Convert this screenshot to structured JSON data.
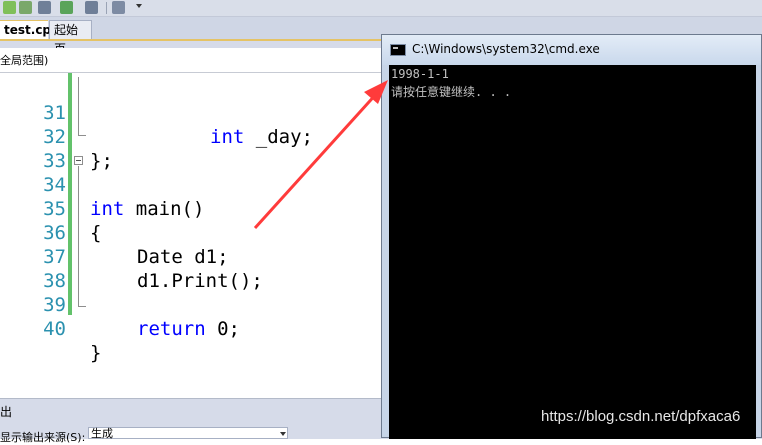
{
  "editor": {
    "tabs": [
      {
        "label": "test.cpp"
      },
      {
        "label": "起始页"
      }
    ],
    "scope_label": "全局范围)",
    "lines": [
      {
        "num": "31"
      },
      {
        "num": "32"
      },
      {
        "num": "33"
      },
      {
        "num": "34"
      },
      {
        "num": "35"
      },
      {
        "num": "36"
      },
      {
        "num": "37"
      },
      {
        "num": "38"
      },
      {
        "num": "39"
      },
      {
        "num": "40"
      }
    ],
    "code": {
      "l31_kw": "int",
      "l31_rest": " _day;",
      "l32": "};",
      "l34_kw": "int",
      "l34_rest": " main()",
      "l35": "{",
      "l36": "Date d1;",
      "l37": "d1.Print();",
      "l39_kw": "return",
      "l39_rest": " 0;",
      "l40": "}"
    }
  },
  "output": {
    "title": "出",
    "source_label": "显示输出来源(S):",
    "source_value": "生成"
  },
  "cmd": {
    "title": "C:\\Windows\\system32\\cmd.exe",
    "lines": [
      "1998-1-1",
      "请按任意键继续. . ."
    ]
  },
  "watermark": "https://blog.csdn.net/dpfxaca6",
  "colors": {
    "keyword": "#0000ff",
    "line_number": "#2b91af",
    "annotation_arrow": "#ff3b3b",
    "console_bg": "#000000"
  }
}
